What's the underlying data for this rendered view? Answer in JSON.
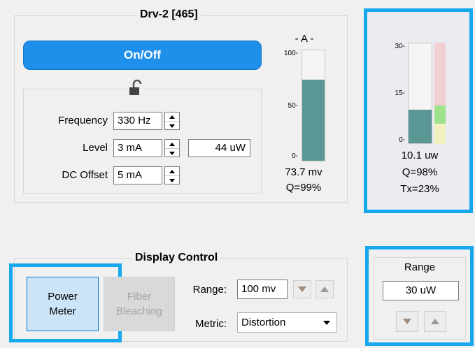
{
  "driver": {
    "title": "Drv-2  [465]",
    "onoff_label": "On/Off",
    "frequency_label": "Frequency",
    "frequency_value": "330 Hz",
    "level_label": "Level",
    "level_value": "3 mA",
    "power_value": "44 uW",
    "dc_offset_label": "DC Offset",
    "dc_offset_value": "5 mA"
  },
  "meter_a": {
    "title": "- A -",
    "ticks": [
      "100-",
      "50-",
      "0-"
    ],
    "fill_fraction": 0.737,
    "fill_color": "#5a9693",
    "reading": "73.7 mv",
    "quality": "Q=99%"
  },
  "meter_right": {
    "ticks": [
      "30-",
      "15-",
      "0-"
    ],
    "main_fill_fraction": 0.337,
    "main_fill_color": "#5a9693",
    "side_segments": [
      {
        "color": "#f2efc0",
        "fraction": 0.2
      },
      {
        "color": "#9fe28a",
        "fraction": 0.18
      },
      {
        "color": "#efcfd0",
        "fraction": 0.62
      }
    ],
    "reading": "10.1 uw",
    "quality": "Q=98%",
    "tx": "Tx=23%"
  },
  "display_control": {
    "title": "Display Control",
    "power_meter_label": [
      "Power",
      "Meter"
    ],
    "fiber_bleaching_label": [
      "Fiber",
      "Bleaching"
    ],
    "range_label": "Range:",
    "range_value": "100 mv",
    "metric_label": "Metric:",
    "metric_value": "Distortion"
  },
  "range_panel": {
    "title": "Range",
    "value": "30 uW"
  },
  "colors": {
    "highlight": "#15a8ec",
    "accent": "#1e90ec"
  }
}
